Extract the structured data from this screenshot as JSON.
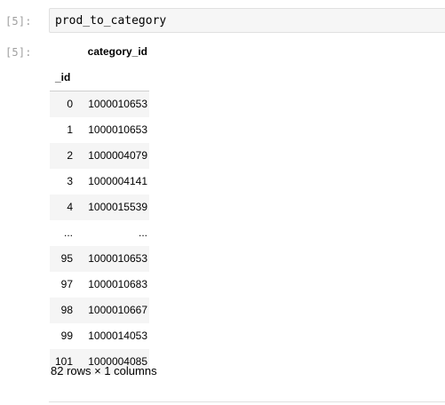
{
  "input_cell": {
    "prompt": "[5]:",
    "code": "prod_to_category"
  },
  "output_cell": {
    "prompt": "[5]:",
    "column_header": "category_id",
    "index_name": "_id",
    "rows": [
      {
        "index": "0",
        "value": "1000010653"
      },
      {
        "index": "1",
        "value": "1000010653"
      },
      {
        "index": "2",
        "value": "1000004079"
      },
      {
        "index": "3",
        "value": "1000004141"
      },
      {
        "index": "4",
        "value": "1000015539"
      },
      {
        "index": "...",
        "value": "..."
      },
      {
        "index": "95",
        "value": "1000010653"
      },
      {
        "index": "97",
        "value": "1000010683"
      },
      {
        "index": "98",
        "value": "1000010667"
      },
      {
        "index": "99",
        "value": "1000014053"
      },
      {
        "index": "101",
        "value": "1000004085"
      }
    ],
    "shape_text": "82 rows × 1 columns"
  }
}
